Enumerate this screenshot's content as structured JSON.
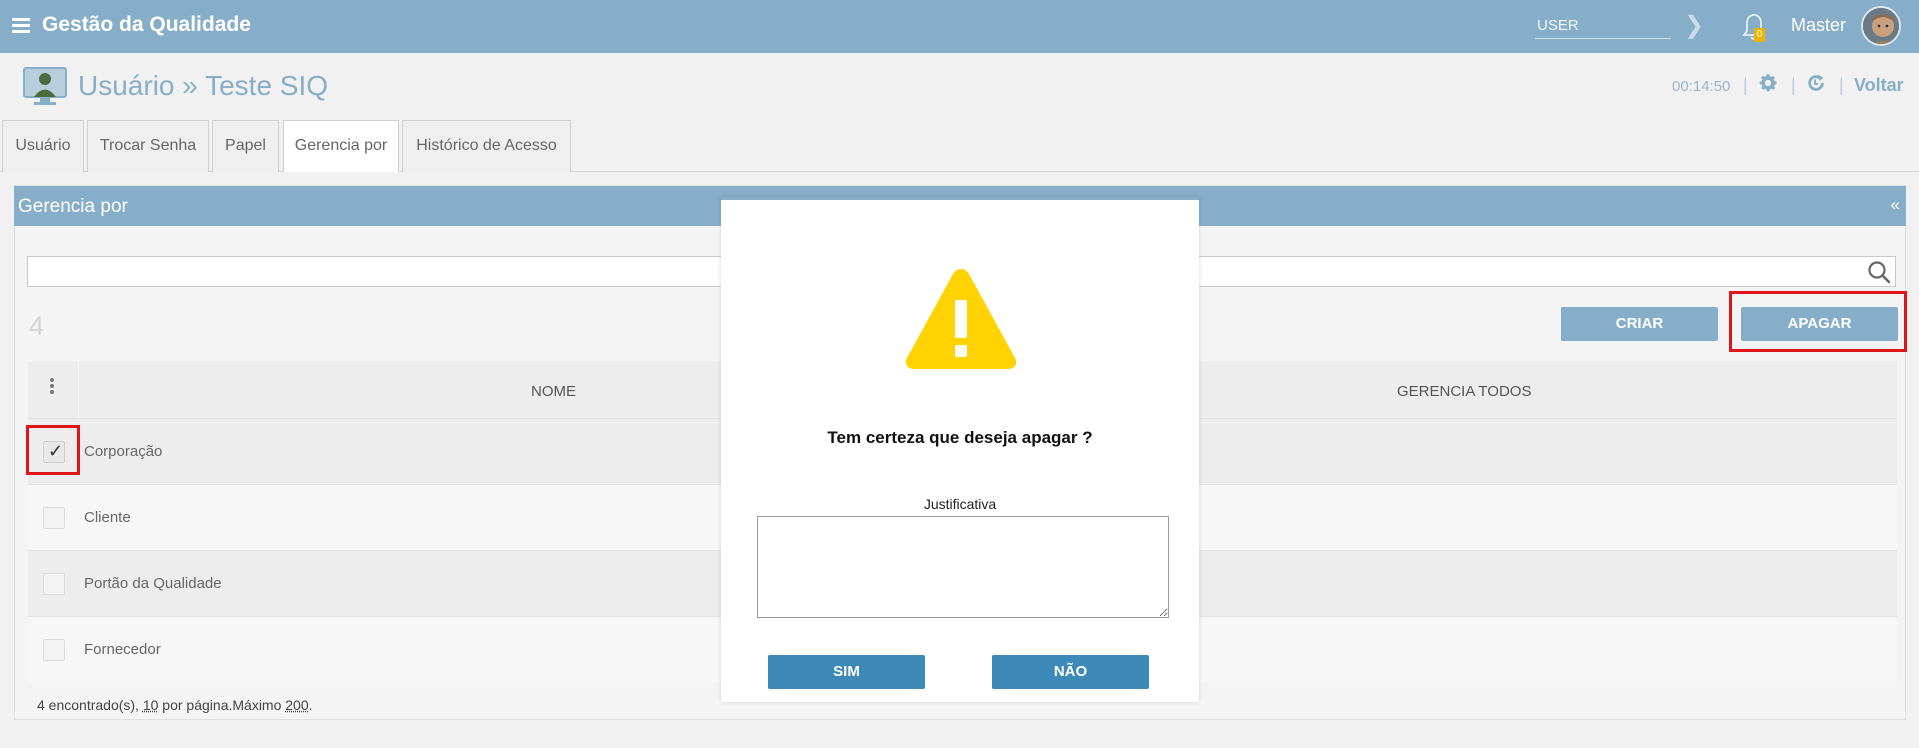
{
  "topbar": {
    "app_title": "Gestão da Qualidade",
    "user_placeholder": "USER",
    "notification_count": "0",
    "username": "Master",
    "color": "#87aec8"
  },
  "header": {
    "title": "Usuário » Teste SIQ",
    "timer": "00:14:50",
    "separator": "|",
    "back_label": "Voltar"
  },
  "tabs": [
    {
      "label": "Usuário"
    },
    {
      "label": "Trocar Senha"
    },
    {
      "label": "Papel"
    },
    {
      "label": "Gerencia por",
      "active": true
    },
    {
      "label": "Histórico de Acesso"
    }
  ],
  "panel": {
    "title": "Gerencia por",
    "collapse_label": "«",
    "search_value": "",
    "count": "4",
    "create_label": "CRIAR",
    "delete_label": "APAGAR"
  },
  "grid": {
    "columns": [
      "NOME",
      "GERENCIA TODOS"
    ],
    "rows": [
      {
        "nome": "Corporação",
        "checked": true
      },
      {
        "nome": "Cliente",
        "checked": false
      },
      {
        "nome": "Portão da Qualidade",
        "checked": false
      },
      {
        "nome": "Fornecedor",
        "checked": false
      }
    ],
    "footer": {
      "prefix": "4 encontrado(s), ",
      "per_page": "10",
      "middle": " por página.Máximo ",
      "max": "200",
      "suffix": "."
    }
  },
  "modal": {
    "question": "Tem certeza que deseja apagar ?",
    "justification_label": "Justificativa",
    "justification_value": "",
    "yes_label": "SIM",
    "no_label": "NÃO",
    "button_color": "#3d8ab9",
    "warning_color": "#ffd200"
  },
  "highlight_color": "#e0141b"
}
